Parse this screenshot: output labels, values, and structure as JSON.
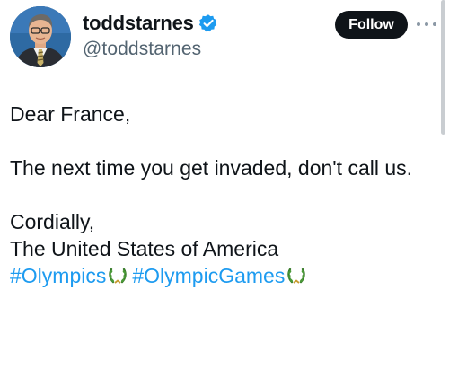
{
  "author": {
    "display_name": "toddstarnes",
    "handle": "@toddstarnes",
    "verified": true,
    "avatar_icon": "avatar-photo"
  },
  "actions": {
    "follow_label": "Follow",
    "more_icon": "more-horizontal-icon"
  },
  "tweet": {
    "greeting": "Dear France,",
    "message": "The next time you get invaded, don't call us.",
    "closing": "Cordially,",
    "signature": "The United States of America",
    "hashtags": [
      "#Olympics",
      "#OlympicGames"
    ],
    "emoji_icon": "olympic-wreath-icon"
  },
  "colors": {
    "text": "#0f1419",
    "secondary": "#536471",
    "link": "#1d9bf0",
    "verified": "#1d9bf0",
    "button_bg": "#0f1419"
  }
}
